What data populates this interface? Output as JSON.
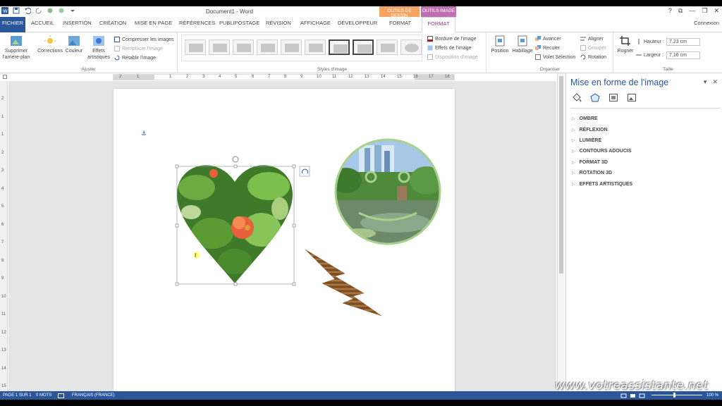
{
  "title_bar": {
    "document_title": "Document1 - Word",
    "context_draw_tools": "OUTILS DE DESSIN",
    "context_image_tools": "OUTILS IMAGE",
    "window_buttons": [
      "?",
      "⧉",
      "—",
      "❐",
      "✕"
    ]
  },
  "tabs": {
    "file": "FICHIER",
    "items": [
      "ACCUEIL",
      "INSERTION",
      "CRÉATION",
      "MISE EN PAGE",
      "RÉFÉRENCES",
      "PUBLIPOSTAGE",
      "RÉVISION",
      "AFFICHAGE",
      "DÉVELOPPEUR",
      "FORMAT",
      "FORMAT"
    ],
    "connexion": "Connexion"
  },
  "ribbon": {
    "adjust": {
      "label": "Ajuster",
      "remove_bg_line1": "Supprimer",
      "remove_bg_line2": "l'arrière-plan",
      "corrections": "Corrections",
      "color": "Couleur",
      "artistic_line1": "Effets",
      "artistic_line2": "artistiques",
      "compress": "Compresser les images",
      "replace": "Remplacer l'image",
      "reset": "Rétablir l'image"
    },
    "styles": {
      "label": "Styles d'image",
      "border": "Bordure de l'image",
      "effects": "Effets de l'image",
      "layout": "Disposition d'image"
    },
    "arrange": {
      "label": "Organiser",
      "position": "Position",
      "wrap": "Habillage",
      "forward": "Avancer",
      "backward": "Reculer",
      "selection_pane": "Volet Sélection",
      "align": "Aligner",
      "group": "Grouper",
      "rotate": "Rotation"
    },
    "size": {
      "label": "Taille",
      "crop": "Rogner",
      "height_label": "Hauteur :",
      "height_value": "7,23 cm",
      "width_label": "Largeur :",
      "width_value": "7,16 cm"
    }
  },
  "ruler": {
    "h_numbers": [
      "2",
      "1",
      "1",
      "2",
      "3",
      "4",
      "5",
      "6",
      "7",
      "8",
      "9",
      "10",
      "11",
      "12",
      "13",
      "14",
      "15",
      "16",
      "17",
      "18"
    ],
    "v_numbers": [
      "2",
      "1",
      "1",
      "2",
      "3",
      "4",
      "5",
      "6",
      "7",
      "8",
      "9",
      "10",
      "11",
      "12",
      "13",
      "14",
      "15",
      "16"
    ]
  },
  "pane": {
    "title": "Mise en forme de l'image",
    "sections": [
      "OMBRE",
      "RÉFLEXION",
      "LUMIÈRE",
      "CONTOURS ADOUCIS",
      "FORMAT 3D",
      "ROTATION 3D",
      "EFFETS ARTISTIQUES"
    ]
  },
  "status": {
    "page": "PAGE 1 SUR 1",
    "words": "0 MOTS",
    "language": "FRANÇAIS (FRANCE)",
    "zoom": "100 %"
  },
  "watermark": "www.votreassistante.net",
  "colors": {
    "word_blue": "#2b579a",
    "draw_context": "#f4a460",
    "image_context": "#c070b0"
  }
}
